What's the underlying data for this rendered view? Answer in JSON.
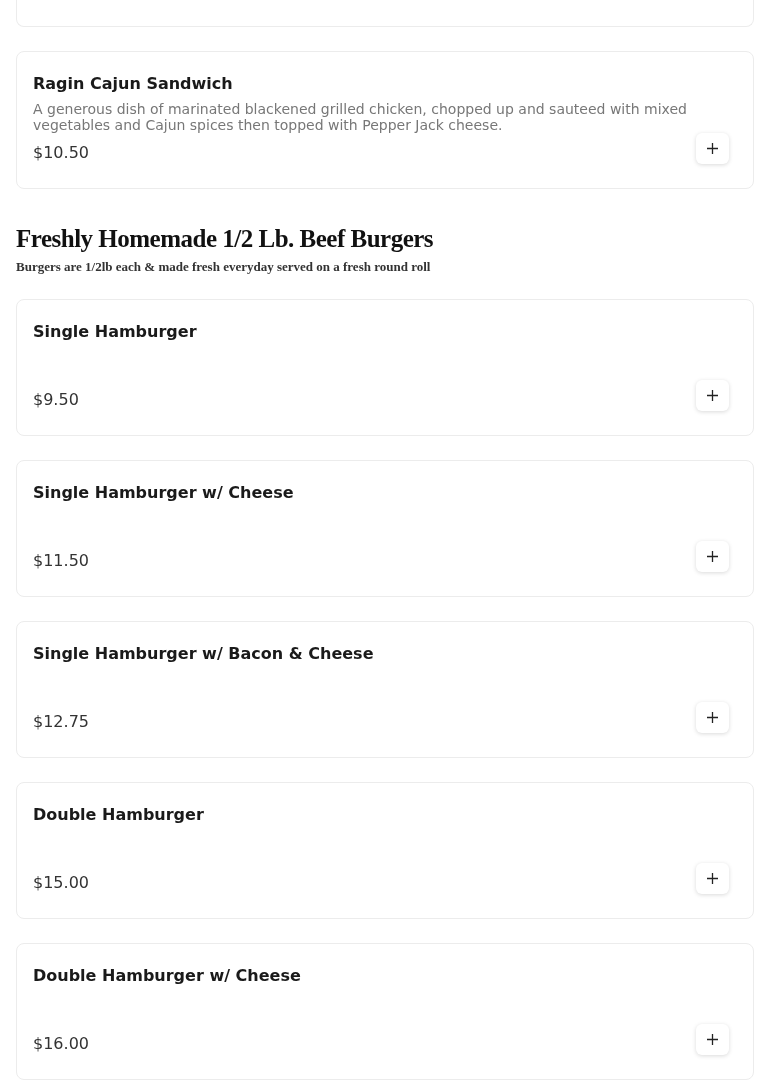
{
  "sections": [
    {
      "items": [
        {
          "name": "Ragin Cajun Sandwich",
          "description": "A generous dish of marinated blackened grilled chicken, chopped up and sauteed with mixed vegetables and Cajun spices then topped with Pepper Jack cheese.",
          "price": "$10.50"
        }
      ]
    },
    {
      "title": "Freshly Homemade 1/2 Lb. Beef Burgers",
      "subtitle": "Burgers are 1/2lb each & made fresh everyday served on a fresh round roll",
      "items": [
        {
          "name": "Single Hamburger",
          "price": "$9.50"
        },
        {
          "name": "Single Hamburger w/ Cheese",
          "price": "$11.50"
        },
        {
          "name": "Single Hamburger w/ Bacon & Cheese",
          "price": "$12.75"
        },
        {
          "name": "Double Hamburger",
          "price": "$15.00"
        },
        {
          "name": "Double Hamburger w/ Cheese",
          "price": "$16.00"
        }
      ]
    }
  ]
}
